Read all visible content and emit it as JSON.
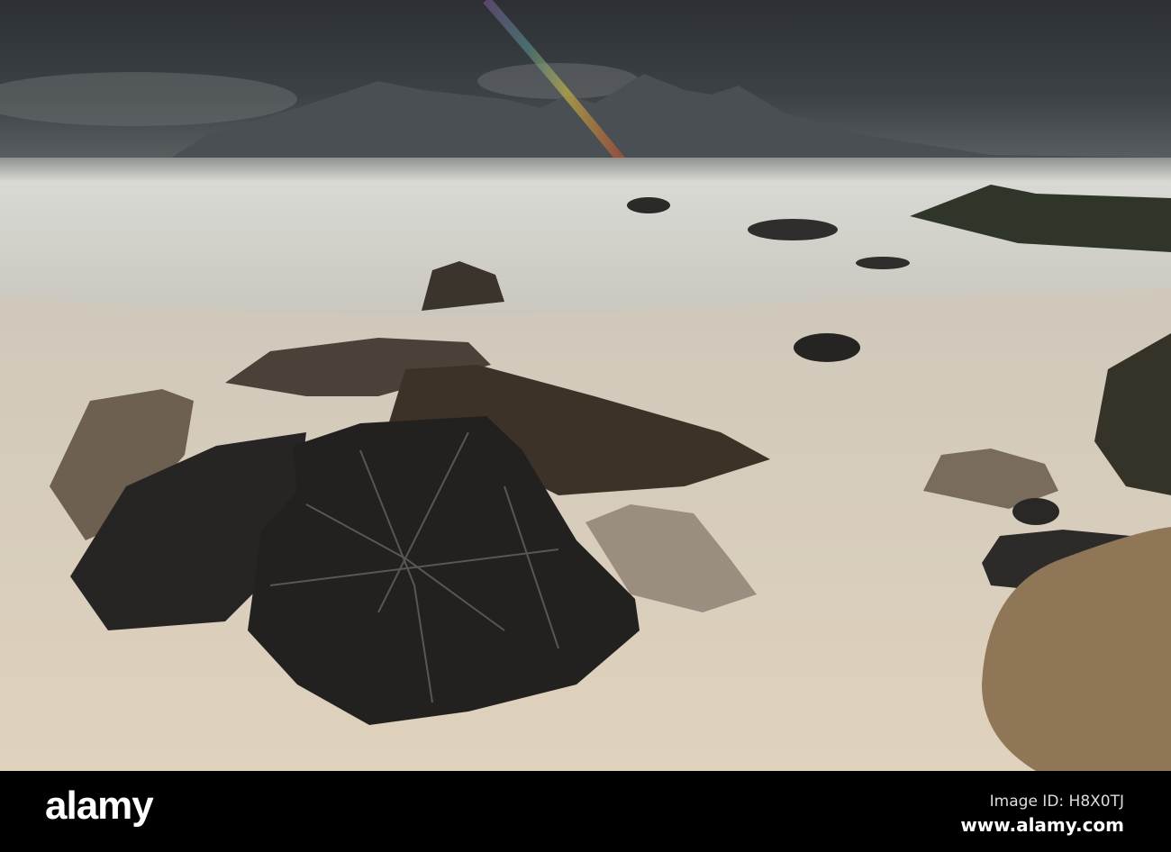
{
  "photo": {
    "description_label": "photo",
    "watermark_text": "alamy"
  },
  "footer": {
    "logo": "alamy",
    "image_id": "Image ID: H8X0TJ",
    "website": "www.alamy.com"
  },
  "colors": {
    "sky": "#3a3e42",
    "sea": "#d9d8d2",
    "sand": "#d6cbb8",
    "rock": "#2a2826",
    "footer": "#000000"
  }
}
